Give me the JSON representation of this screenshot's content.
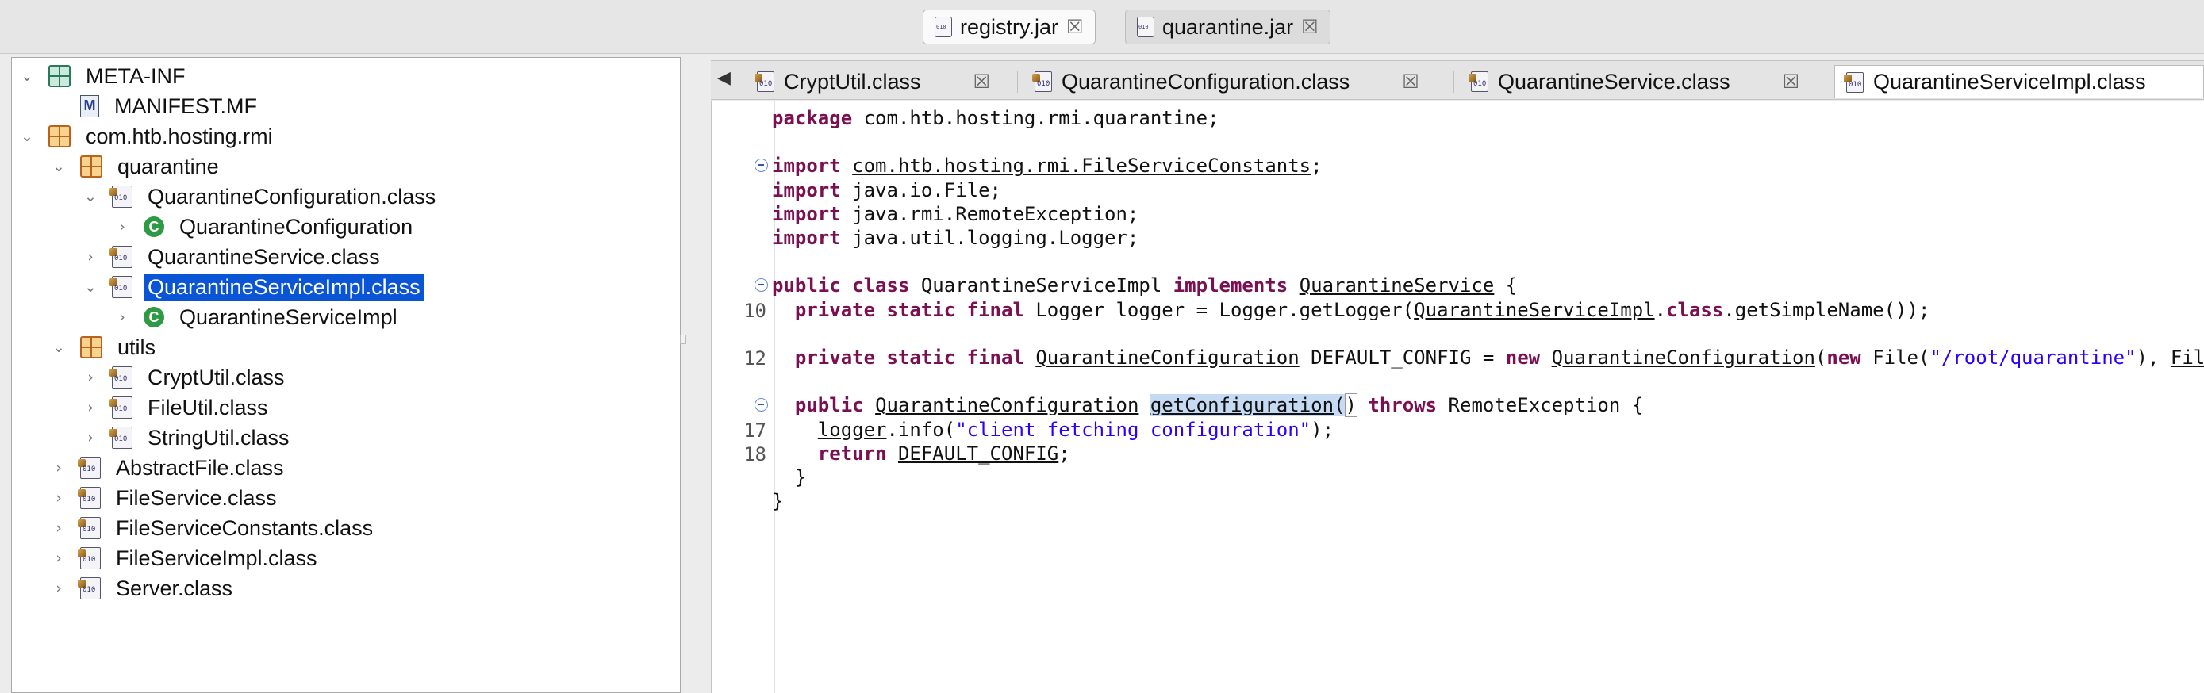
{
  "jar_tabs": [
    {
      "label": "registry.jar",
      "active": true
    },
    {
      "label": "quarantine.jar",
      "active": false
    }
  ],
  "tree": [
    {
      "label": "META-INF",
      "depth": 0,
      "expand": "expanded",
      "icon": "folder-meta-inf-icon"
    },
    {
      "label": "MANIFEST.MF",
      "depth": 1,
      "expand": "none",
      "icon": "manifest-file-icon"
    },
    {
      "label": "com.htb.hosting.rmi",
      "depth": 0,
      "expand": "expanded",
      "icon": "package-icon"
    },
    {
      "label": "quarantine",
      "depth": 1,
      "expand": "expanded",
      "icon": "package-icon"
    },
    {
      "label": "QuarantineConfiguration.class",
      "depth": 2,
      "expand": "expanded",
      "icon": "class-file-icon"
    },
    {
      "label": "QuarantineConfiguration",
      "depth": 3,
      "expand": "collapsed",
      "icon": "class-type-icon"
    },
    {
      "label": "QuarantineService.class",
      "depth": 2,
      "expand": "collapsed",
      "icon": "class-file-icon"
    },
    {
      "label": "QuarantineServiceImpl.class",
      "depth": 2,
      "expand": "expanded",
      "icon": "class-file-icon",
      "selected": true
    },
    {
      "label": "QuarantineServiceImpl",
      "depth": 3,
      "expand": "collapsed",
      "icon": "class-type-icon"
    },
    {
      "label": "utils",
      "depth": 1,
      "expand": "expanded",
      "icon": "package-icon"
    },
    {
      "label": "CryptUtil.class",
      "depth": 2,
      "expand": "collapsed",
      "icon": "class-file-icon"
    },
    {
      "label": "FileUtil.class",
      "depth": 2,
      "expand": "collapsed",
      "icon": "class-file-icon"
    },
    {
      "label": "StringUtil.class",
      "depth": 2,
      "expand": "collapsed",
      "icon": "class-file-icon"
    },
    {
      "label": "AbstractFile.class",
      "depth": 1,
      "expand": "collapsed",
      "icon": "class-file-icon"
    },
    {
      "label": "FileService.class",
      "depth": 1,
      "expand": "collapsed",
      "icon": "class-file-icon"
    },
    {
      "label": "FileServiceConstants.class",
      "depth": 1,
      "expand": "collapsed",
      "icon": "class-file-icon"
    },
    {
      "label": "FileServiceImpl.class",
      "depth": 1,
      "expand": "collapsed",
      "icon": "class-file-icon"
    },
    {
      "label": "Server.class",
      "depth": 1,
      "expand": "collapsed",
      "icon": "class-file-icon"
    }
  ],
  "editor": {
    "tabs": [
      {
        "label": "CryptUtil.class",
        "active": false
      },
      {
        "label": "QuarantineConfiguration.class",
        "active": false
      },
      {
        "label": "QuarantineService.class",
        "active": false
      },
      {
        "label": "QuarantineServiceImpl.class",
        "active": true
      }
    ],
    "lines": [
      {
        "num": "",
        "fold": false,
        "segs": [
          {
            "t": "package",
            "c": "kw"
          },
          {
            "t": " com.htb.hosting.rmi.quarantine;"
          }
        ]
      },
      {
        "num": "",
        "fold": false,
        "segs": []
      },
      {
        "num": "",
        "fold": true,
        "segs": [
          {
            "t": "import",
            "c": "kw"
          },
          {
            "t": " "
          },
          {
            "t": "com.htb.hosting.rmi.FileServiceConstants",
            "c": "u"
          },
          {
            "t": ";"
          }
        ]
      },
      {
        "num": "",
        "fold": false,
        "segs": [
          {
            "t": "import",
            "c": "kw"
          },
          {
            "t": " java.io.File;"
          }
        ]
      },
      {
        "num": "",
        "fold": false,
        "segs": [
          {
            "t": "import",
            "c": "kw"
          },
          {
            "t": " java.rmi.RemoteException;"
          }
        ]
      },
      {
        "num": "",
        "fold": false,
        "segs": [
          {
            "t": "import",
            "c": "kw"
          },
          {
            "t": " java.util.logging.Logger;"
          }
        ]
      },
      {
        "num": "",
        "fold": false,
        "segs": []
      },
      {
        "num": "",
        "fold": true,
        "segs": [
          {
            "t": "public class",
            "c": "kw"
          },
          {
            "t": " QuarantineServiceImpl "
          },
          {
            "t": "implements",
            "c": "kw"
          },
          {
            "t": " "
          },
          {
            "t": "QuarantineService",
            "c": "u"
          },
          {
            "t": " {"
          }
        ]
      },
      {
        "num": "10",
        "fold": false,
        "segs": [
          {
            "t": "  "
          },
          {
            "t": "private static final",
            "c": "kw"
          },
          {
            "t": " Logger logger = Logger.getLogger("
          },
          {
            "t": "QuarantineServiceImpl",
            "c": "u"
          },
          {
            "t": "."
          },
          {
            "t": "class",
            "c": "kw"
          },
          {
            "t": ".getSimpleName());"
          }
        ]
      },
      {
        "num": "",
        "fold": false,
        "segs": []
      },
      {
        "num": "12",
        "fold": false,
        "segs": [
          {
            "t": "  "
          },
          {
            "t": "private static final",
            "c": "kw"
          },
          {
            "t": " "
          },
          {
            "t": "QuarantineConfiguration",
            "c": "u"
          },
          {
            "t": " DEFAULT_CONFIG = "
          },
          {
            "t": "new",
            "c": "kw"
          },
          {
            "t": " "
          },
          {
            "t": "QuarantineConfiguration",
            "c": "u"
          },
          {
            "t": "("
          },
          {
            "t": "new",
            "c": "kw"
          },
          {
            "t": " File("
          },
          {
            "t": "\"/root/quarantine\"",
            "c": "str"
          },
          {
            "t": "), "
          },
          {
            "t": "FileSe",
            "c": "u"
          }
        ]
      },
      {
        "num": "",
        "fold": false,
        "segs": []
      },
      {
        "num": "",
        "fold": true,
        "segs": [
          {
            "t": "  "
          },
          {
            "t": "public",
            "c": "kw"
          },
          {
            "t": " "
          },
          {
            "t": "QuarantineConfiguration",
            "c": "u"
          },
          {
            "t": " "
          },
          {
            "t": "getConfiguration",
            "c": "u hl"
          },
          {
            "t": "(",
            "c": "hl"
          },
          {
            "t": ")",
            "c": "bm"
          },
          {
            "t": " "
          },
          {
            "t": "throws",
            "c": "kw"
          },
          {
            "t": " RemoteException {"
          }
        ]
      },
      {
        "num": "17",
        "fold": false,
        "segs": [
          {
            "t": "    "
          },
          {
            "t": "logger",
            "c": "u"
          },
          {
            "t": ".info("
          },
          {
            "t": "\"client fetching configuration\"",
            "c": "str"
          },
          {
            "t": ");"
          }
        ]
      },
      {
        "num": "18",
        "fold": false,
        "segs": [
          {
            "t": "    "
          },
          {
            "t": "return",
            "c": "kw"
          },
          {
            "t": " "
          },
          {
            "t": "DEFAULT_CONFIG",
            "c": "u"
          },
          {
            "t": ";"
          }
        ]
      },
      {
        "num": "",
        "fold": false,
        "segs": [
          {
            "t": "  }"
          }
        ]
      },
      {
        "num": "",
        "fold": false,
        "segs": [
          {
            "t": "}"
          }
        ]
      }
    ]
  }
}
